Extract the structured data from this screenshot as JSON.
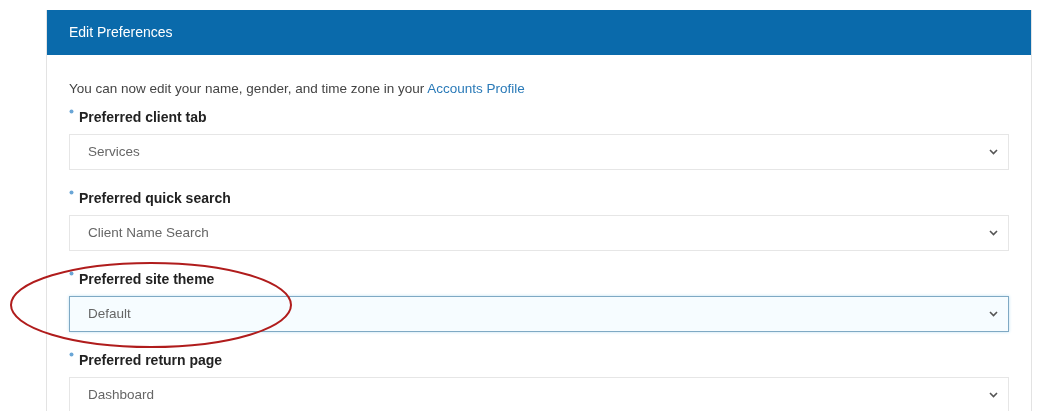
{
  "panel": {
    "title": "Edit Preferences"
  },
  "intro": {
    "text": "You can now edit your name, gender, and time zone in your",
    "link": "Accounts Profile"
  },
  "fields": [
    {
      "label": "Preferred client tab",
      "required": true,
      "value": "Services",
      "focused": false
    },
    {
      "label": "Preferred quick search",
      "required": true,
      "value": "Client Name Search",
      "focused": false
    },
    {
      "label": "Preferred site theme",
      "required": true,
      "value": "Default",
      "focused": true
    },
    {
      "label": "Preferred return page",
      "required": true,
      "value": "Dashboard",
      "focused": false
    }
  ],
  "annotation": {
    "kind": "ellipse",
    "color": "#b01c1c"
  }
}
